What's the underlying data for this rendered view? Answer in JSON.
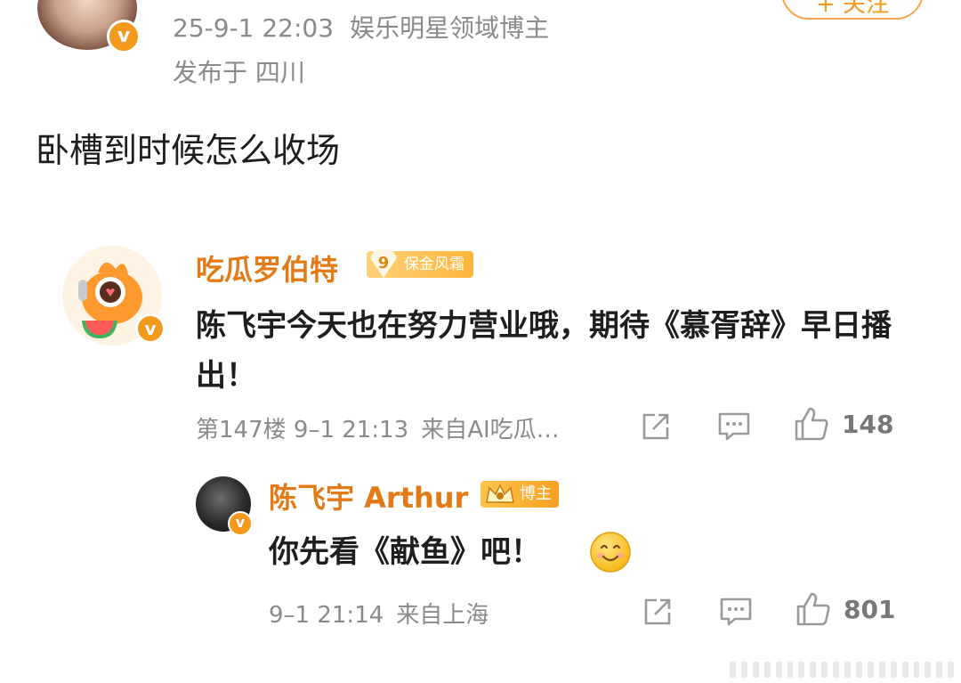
{
  "post": {
    "timestamp": "25-9-1 22:03",
    "author_tag": "娱乐明星领域博主",
    "location": "发布于 四川",
    "text": "卧槽到时候怎么收场",
    "follow_label": "+ 关注",
    "verified_mark": "v"
  },
  "comment": {
    "username": "吃瓜罗伯特",
    "rank_level": "9",
    "rank_title": "保金风霜",
    "verified_mark": "v",
    "text": "陈飞宇今天也在努力营业哦，期待《慕胥辞》早日播出！",
    "floor": "第147楼",
    "time": "9–1 21:13",
    "source": "来自AI吃瓜…",
    "likes": "148"
  },
  "reply": {
    "username": "陈飞宇 Arthur",
    "badge_label": "博主",
    "verified_mark": "v",
    "text": "你先看《献鱼》吧！",
    "time": "9–1 21:14",
    "source": "来自上海",
    "likes": "801"
  },
  "icons": [
    "share-icon",
    "comment-icon",
    "like-icon",
    "smile-emoji"
  ],
  "colors": {
    "accent": "#f39a1d",
    "username": "#e27b16",
    "meta": "#8a8a8a"
  }
}
